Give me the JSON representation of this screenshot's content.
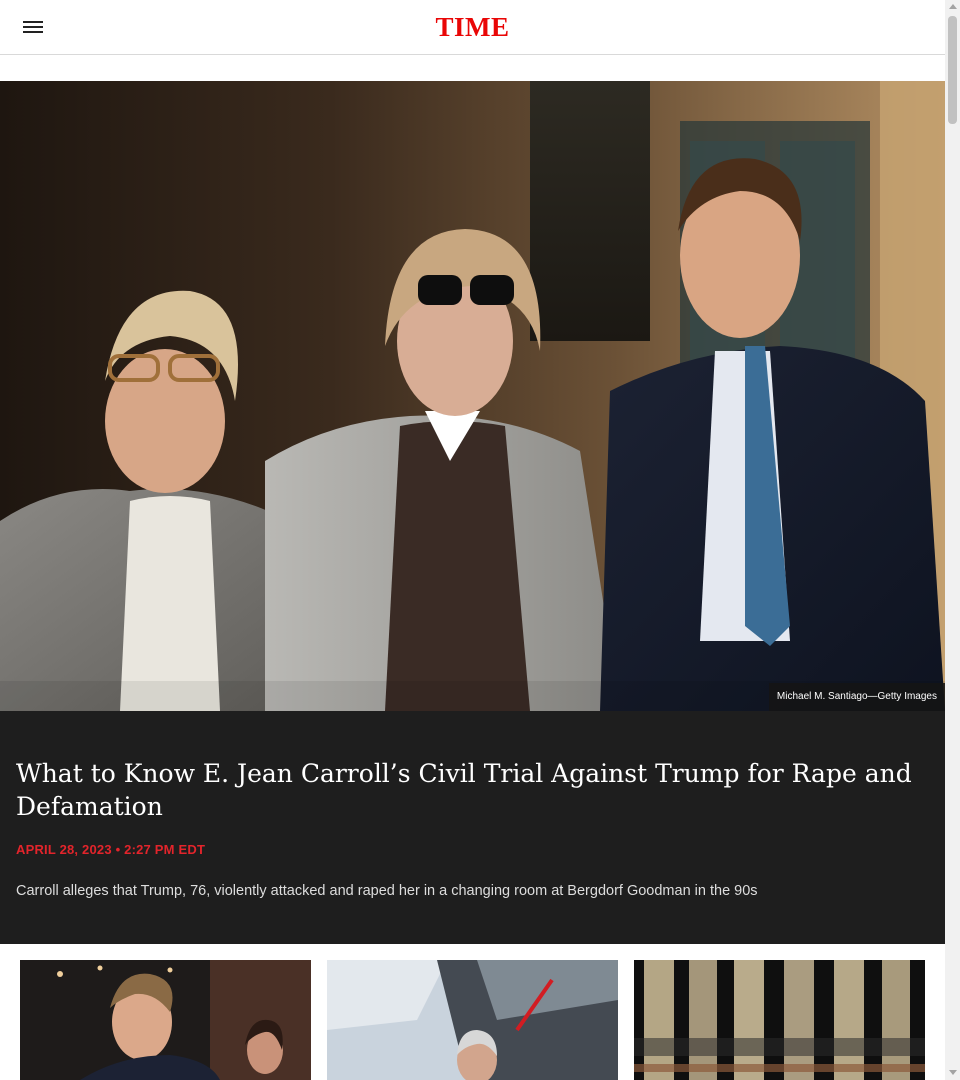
{
  "header": {
    "logo_text": "TIME",
    "menu_icon": "hamburger-menu-icon",
    "brand_color": "#e90606"
  },
  "hero": {
    "image_description_icon": "photo",
    "credit": "Michael M. Santiago—Getty Images"
  },
  "article": {
    "headline": "What to Know E. Jean Carroll’s Civil Trial Against Trump for Rape and Defamation",
    "dateline": "APRIL 28, 2023 • 2:27 PM EDT",
    "summary": "Carroll alleges that Trump, 76, violently attacked and raped her in a changing room at Bergdorf Goodman in the 90s",
    "dateline_color": "#e3242b",
    "band_color": "#1e1e1e"
  },
  "cards": [
    {
      "icon": "photo"
    },
    {
      "icon": "photo"
    },
    {
      "icon": "photo"
    }
  ]
}
